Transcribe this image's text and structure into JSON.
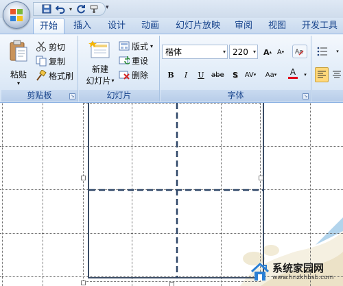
{
  "quick_access": {
    "icons": [
      "save-icon",
      "undo-icon",
      "redo-icon",
      "format-painter-icon"
    ]
  },
  "tabs": [
    "开始",
    "插入",
    "设计",
    "动画",
    "幻灯片放映",
    "审阅",
    "视图",
    "开发工具"
  ],
  "active_tab": "开始",
  "clipboard": {
    "paste_label": "粘贴",
    "cut_label": "剪切",
    "copy_label": "复制",
    "format_painter_label": "格式刷",
    "group_label": "剪贴板"
  },
  "slides": {
    "new_slide_line1": "新建",
    "new_slide_line2": "幻灯片",
    "layout_label": "版式",
    "reset_label": "重设",
    "delete_label": "删除",
    "group_label": "幻灯片"
  },
  "font": {
    "font_name": "楷体",
    "font_size": "220",
    "grow_label": "A",
    "shrink_label": "A",
    "bold_label": "B",
    "italic_label": "I",
    "underline_label": "U",
    "strike_label": "abe",
    "shadow_label": "S",
    "spacing_label": "AV",
    "case_label": "Aa",
    "color_label": "A",
    "group_label": "字体"
  },
  "colors": {
    "accent": "#15428b",
    "font_color_bar": "#e2001a",
    "active_align": "#ffd87a"
  },
  "watermark": {
    "name": "系统家园网",
    "url": "www.hnzkhbsb.com"
  }
}
